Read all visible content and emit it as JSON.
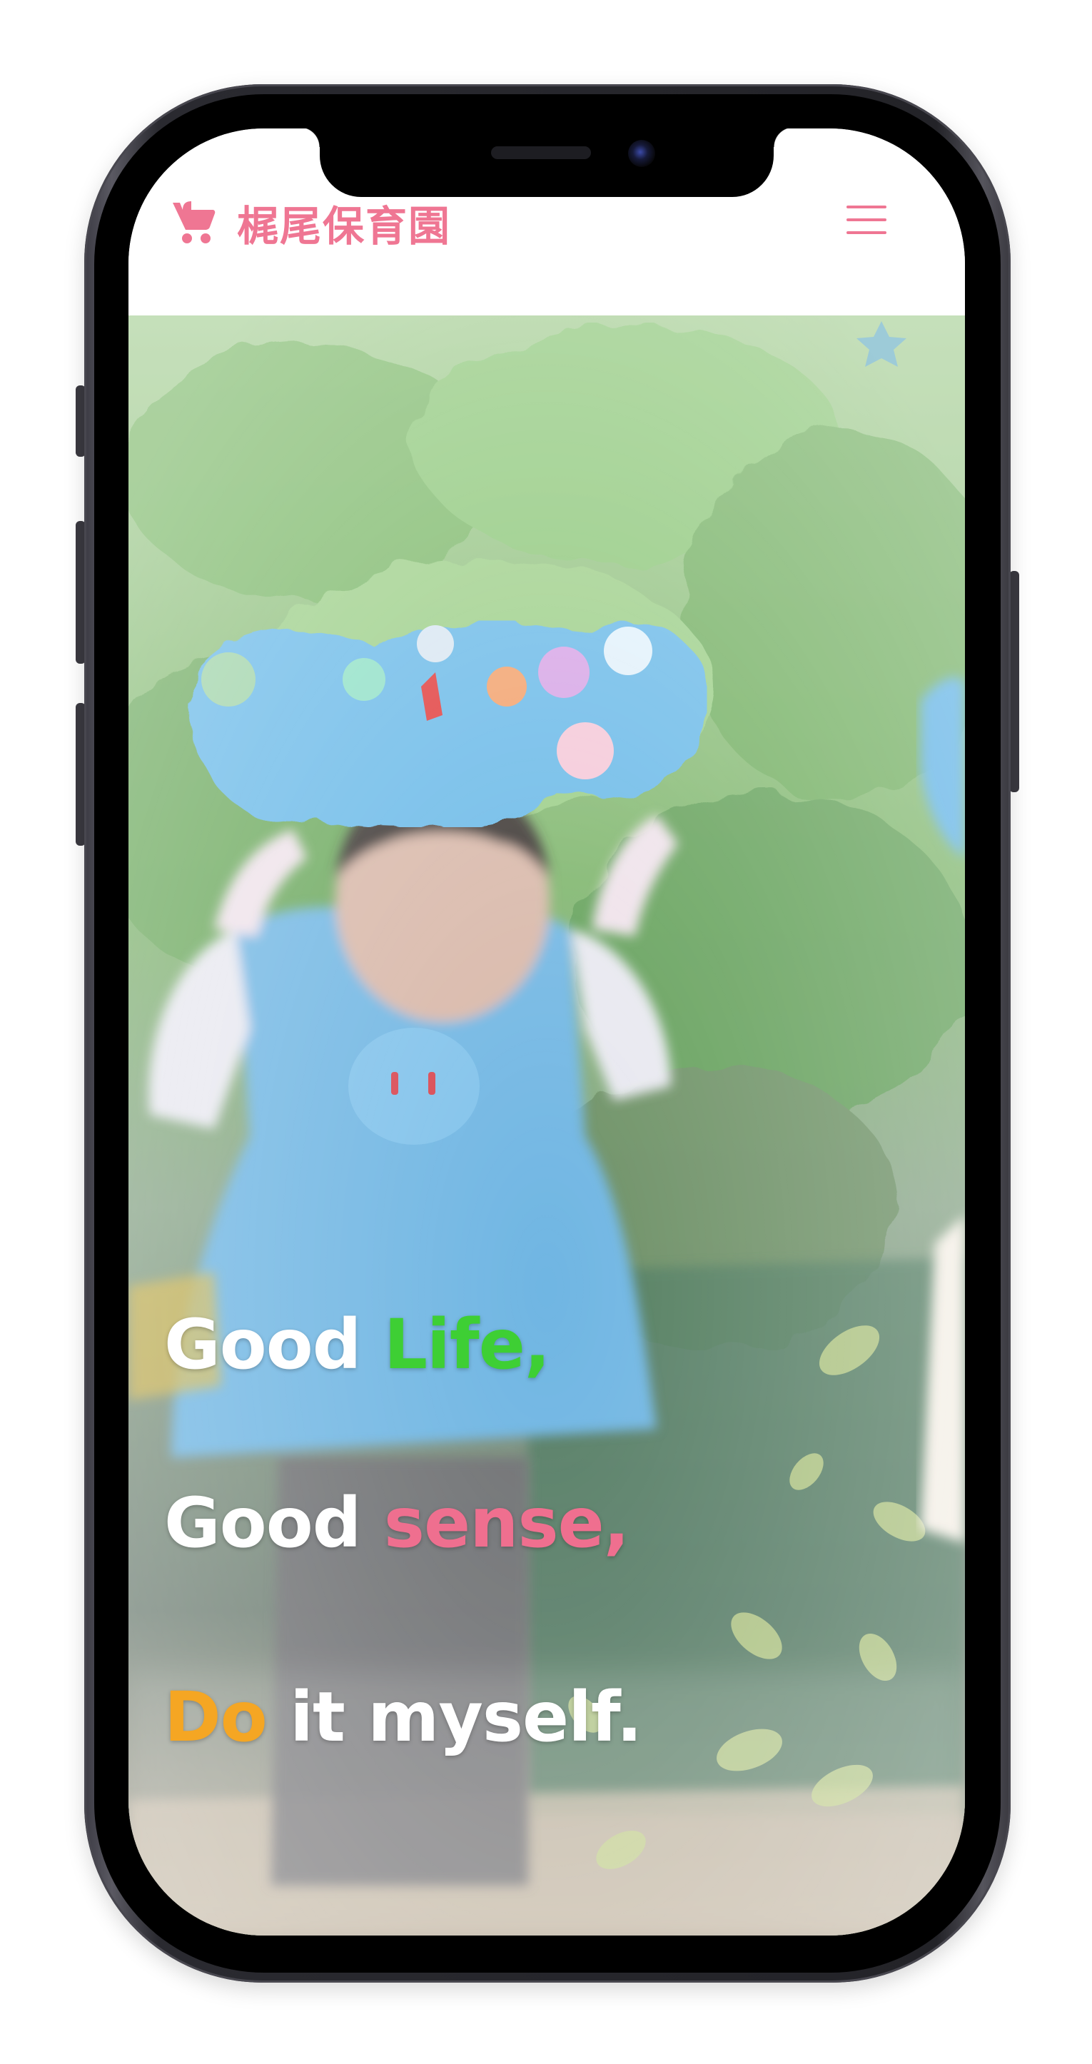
{
  "header": {
    "brand_title": "梶尾保育園",
    "brand_icon": "baby-stroller-icon",
    "menu_icon": "hamburger-menu-icon"
  },
  "hero": {
    "slogan": [
      {
        "first": "Good",
        "accent": "Life,",
        "rest": ""
      },
      {
        "first": "Good",
        "accent": "sense,",
        "rest": ""
      },
      {
        "first": "Do",
        "accent": "",
        "rest": "it myself."
      }
    ]
  },
  "colors": {
    "brand_pink": "#ef7693",
    "accent_green": "#3ecf34",
    "accent_pink": "#ef6f8f",
    "accent_orange": "#f5a623",
    "text_white": "#ffffff"
  }
}
